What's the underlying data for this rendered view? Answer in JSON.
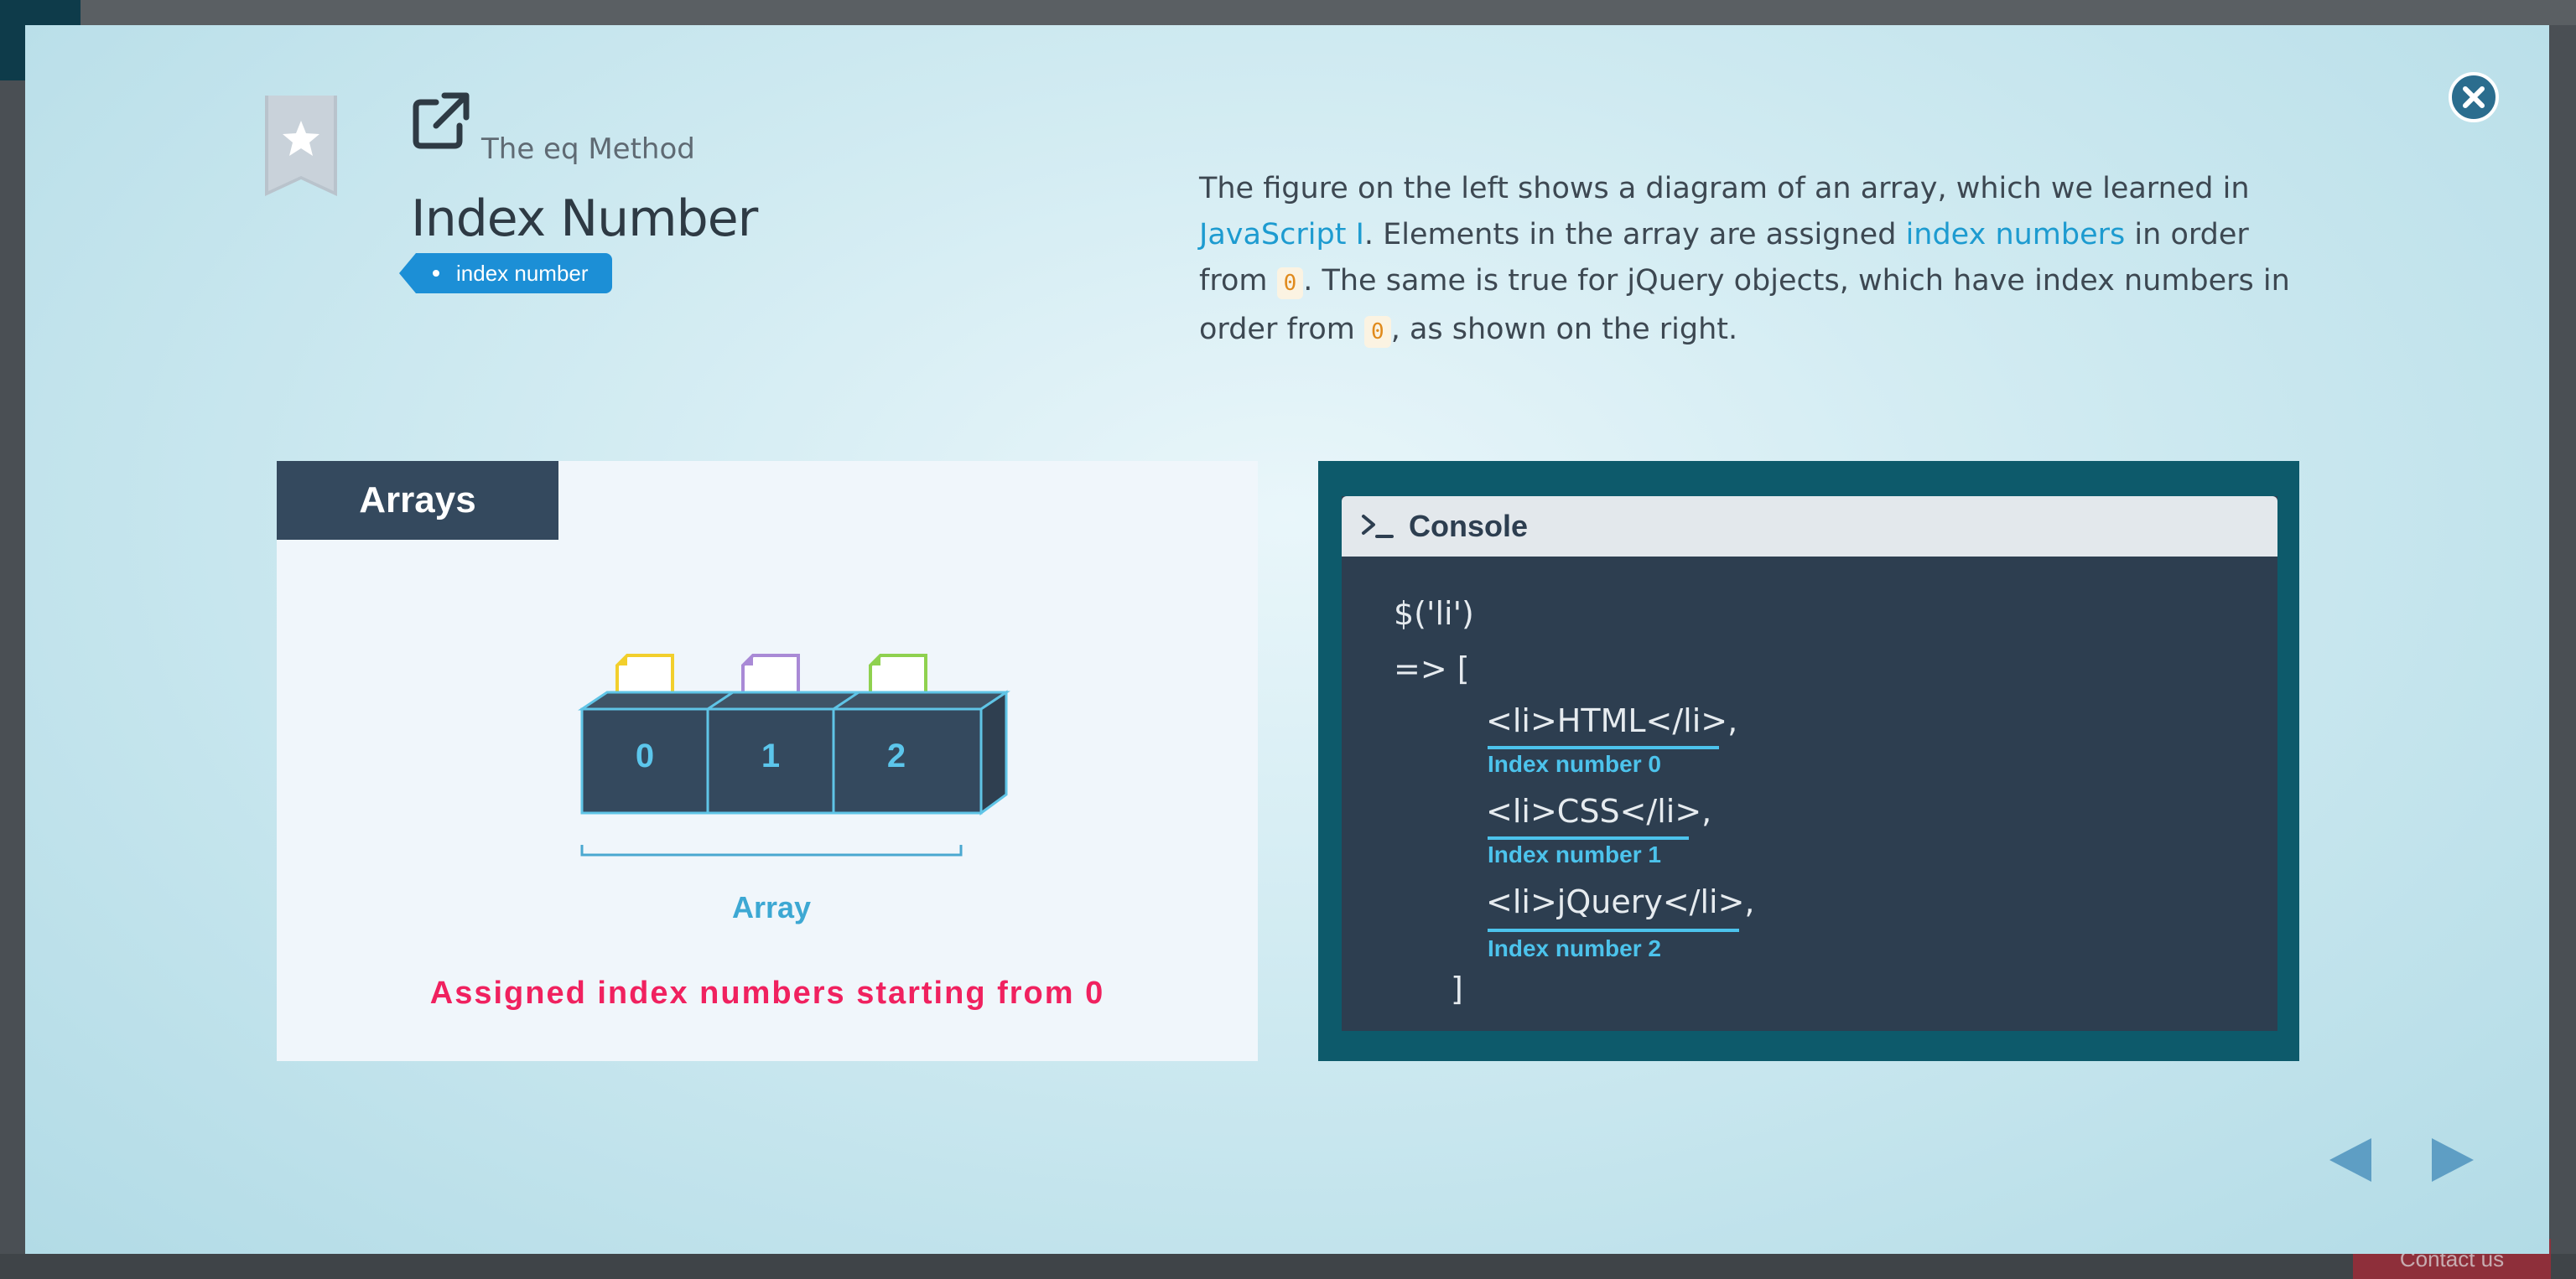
{
  "background": {
    "contact_label": "Contact us"
  },
  "header": {
    "subtitle": "The eq Method",
    "title": "Index Number",
    "tag_label": "index number"
  },
  "description": {
    "p1": "The figure on the left shows a diagram of an array, which we learned in ",
    "link1": "JavaScript I",
    "p2": ". Elements in the array are assigned ",
    "link2": "index numbers",
    "p3": " in order from ",
    "code1": "0",
    "p4": ". The same is true for jQuery objects, which have index numbers in order from ",
    "code2": "0",
    "p5": ", as shown on the right."
  },
  "left_figure": {
    "header": "Arrays",
    "slots": [
      "0",
      "1",
      "2"
    ],
    "array_label": "Array",
    "caption": "Assigned index numbers starting from 0"
  },
  "console": {
    "title": "Console",
    "line1": "$('li')",
    "line2": "=> [",
    "items": [
      {
        "code": "<li>HTML</li>,",
        "index": "Index number 0"
      },
      {
        "code": "<li>CSS</li>,",
        "index": "Index number 1"
      },
      {
        "code": "<li>jQuery</li>,",
        "index": "Index number 2"
      }
    ],
    "closing": "]"
  },
  "colors": {
    "accent": "#1d9bd0",
    "tag": "#1c8fd6",
    "caption_red": "#f0215f",
    "index_blue": "#4cc3ec",
    "paper_yellow": "#f2cf2c",
    "paper_purple": "#a98ad6",
    "paper_green": "#8fd14f"
  }
}
